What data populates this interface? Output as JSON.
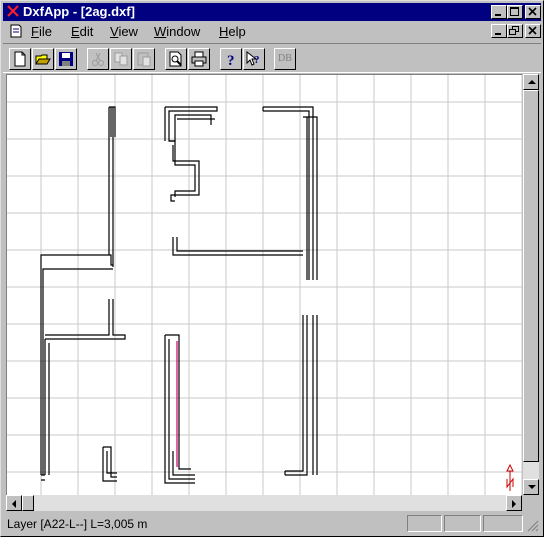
{
  "window": {
    "title": "DxfApp - [2ag.dxf]"
  },
  "menu": {
    "items": [
      {
        "label": "File",
        "key": "file"
      },
      {
        "label": "Edit",
        "key": "edit"
      },
      {
        "label": "View",
        "key": "view"
      },
      {
        "label": "Window",
        "key": "window"
      },
      {
        "label": "Help",
        "key": "help"
      }
    ]
  },
  "toolbar": {
    "buttons": [
      "new-icon",
      "open-icon",
      "save-icon",
      "cut-icon",
      "copy-icon",
      "paste-icon",
      "print-preview-icon",
      "print-icon",
      "help-icon",
      "context-help-icon"
    ],
    "db_label": "DB"
  },
  "status": {
    "text": "Layer [A22-L--] L=3,005 m"
  },
  "colors": {
    "title_bg": "#000080",
    "face": "#c0c0c0",
    "drawing": "#000000",
    "highlight": "#cc0066",
    "north": "#cc0000"
  }
}
